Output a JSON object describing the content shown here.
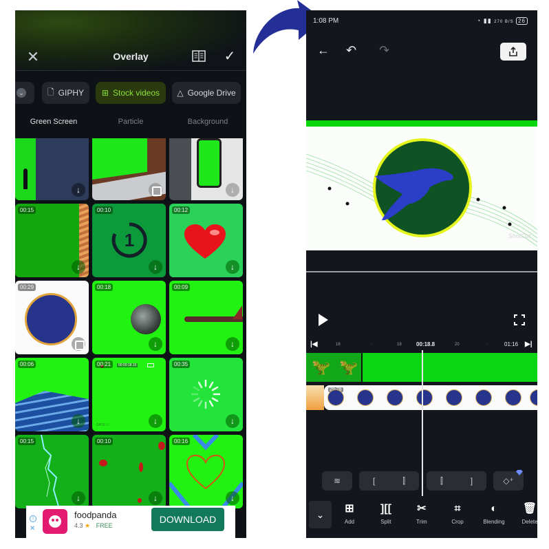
{
  "left_screen": {
    "header": {
      "close_icon": "✕",
      "title": "Overlay",
      "guide_icon": "book-icon",
      "confirm_icon": "✓"
    },
    "source_chips": [
      {
        "label": "",
        "icon": "chevron-down-icon",
        "active": false
      },
      {
        "label": "GIPHY",
        "icon": "file-icon",
        "active": false
      },
      {
        "label": "Stock videos",
        "icon": "grid-icon",
        "active": true
      },
      {
        "label": "Google Drive",
        "icon": "drive-icon",
        "active": false
      }
    ],
    "category_tabs": [
      {
        "label": "Green Screen",
        "active": true
      },
      {
        "label": "Particle",
        "active": false
      },
      {
        "label": "Background",
        "active": false
      }
    ],
    "tiles": [
      {
        "duration": "",
        "subject": "person in doorway",
        "action": "download"
      },
      {
        "duration": "",
        "subject": "laptop typing",
        "action": "expand"
      },
      {
        "duration": "",
        "subject": "smartphone",
        "action": "download"
      },
      {
        "duration": "00:15",
        "subject": "autumn leaves border",
        "action": "download"
      },
      {
        "duration": "00:10",
        "subject": "countdown 1",
        "action": "download"
      },
      {
        "duration": "00:12",
        "subject": "red heart",
        "action": "download"
      },
      {
        "duration": "00:29",
        "subject": "blue circle music staff",
        "action": "expand"
      },
      {
        "duration": "00:18",
        "subject": "earth globe",
        "action": "download"
      },
      {
        "duration": "00:09",
        "subject": "airplane",
        "action": "download"
      },
      {
        "duration": "00:06",
        "subject": "ocean wave",
        "action": "download"
      },
      {
        "duration": "00:21",
        "subject": "camera REC overlay",
        "action": "download"
      },
      {
        "duration": "00:35",
        "subject": "loading spinner",
        "action": "download"
      },
      {
        "duration": "00:15",
        "subject": "lightning bolt",
        "action": "download"
      },
      {
        "duration": "00:10",
        "subject": "rose petals",
        "action": "download"
      },
      {
        "duration": "00:16",
        "subject": "heart outline",
        "action": "download"
      }
    ],
    "rec_overlay": {
      "rec": "REC",
      "timecode": "00:00:18.10",
      "date": "DATE  /  /",
      "time": "TIME"
    },
    "ad": {
      "app_name": "foodpanda",
      "rating": "4.3",
      "price": "FREE",
      "button": "DOWNLOAD",
      "star": "★"
    }
  },
  "right_screen": {
    "status_bar": {
      "time": "1:08 PM",
      "network_speed": "270 B/S",
      "battery": "26"
    },
    "toolbar": {
      "back_icon": "←",
      "undo_icon": "↶",
      "redo_icon": "↷",
      "export_icon": "⇪"
    },
    "preview": {
      "watermark": "ShotCut"
    },
    "timeline": {
      "ruler_ticks": [
        "16",
        "·",
        "18",
        "20",
        "·"
      ],
      "current_time": "00:18.8",
      "end_time": "01:16",
      "overlay_clip_duration": "29:28"
    },
    "mini_controls": [
      {
        "name": "layers",
        "icons": [
          "≋"
        ]
      },
      {
        "name": "trim-start",
        "icons": [
          "[",
          "⫿"
        ]
      },
      {
        "name": "trim-end",
        "icons": [
          "⫿",
          "]"
        ]
      },
      {
        "name": "keyframe",
        "icons": [
          "◇⁺"
        ]
      }
    ],
    "tools": [
      {
        "label": "Add",
        "icon": "⊞"
      },
      {
        "label": "Split",
        "icon": "][["
      },
      {
        "label": "Trim",
        "icon": "✂"
      },
      {
        "label": "Crop",
        "icon": "⌗"
      },
      {
        "label": "Blending",
        "icon": "◐"
      },
      {
        "label": "Delete",
        "icon": "🗑"
      }
    ],
    "collapse_icon": "⌄"
  },
  "colors": {
    "accent_green": "#8ee03a",
    "chroma_green": "#0ad613",
    "arrow_blue": "#232f96",
    "ad_button": "#13795b",
    "brand_pink": "#e21b70"
  }
}
